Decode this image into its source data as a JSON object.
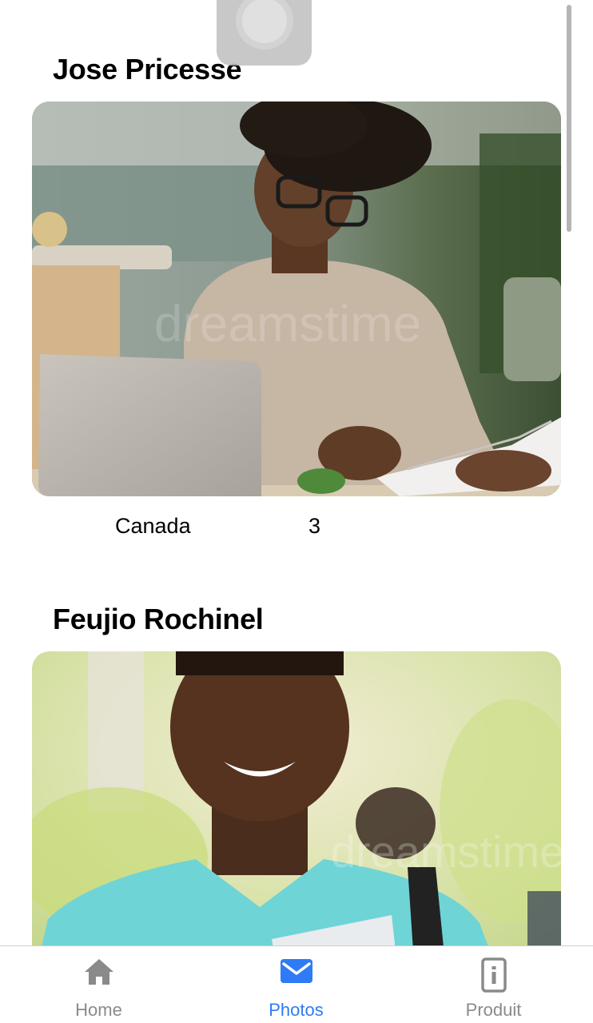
{
  "feed": {
    "cards": [
      {
        "name": "Jose Pricesse",
        "country": "Canada",
        "count": "3",
        "photo_watermark": "dreamstime"
      },
      {
        "name": "Feujio Rochinel",
        "photo_watermark": "dreamstime"
      }
    ]
  },
  "tabbar": {
    "tabs": [
      {
        "label": "Home",
        "icon": "house-icon",
        "active": false
      },
      {
        "label": "Photos",
        "icon": "envelope-icon",
        "active": true
      },
      {
        "label": "Produit",
        "icon": "info-phone-icon",
        "active": false
      }
    ]
  },
  "colors": {
    "accent": "#2f7bf6",
    "inactive": "#8a8a8a",
    "background": "#ffffff"
  }
}
